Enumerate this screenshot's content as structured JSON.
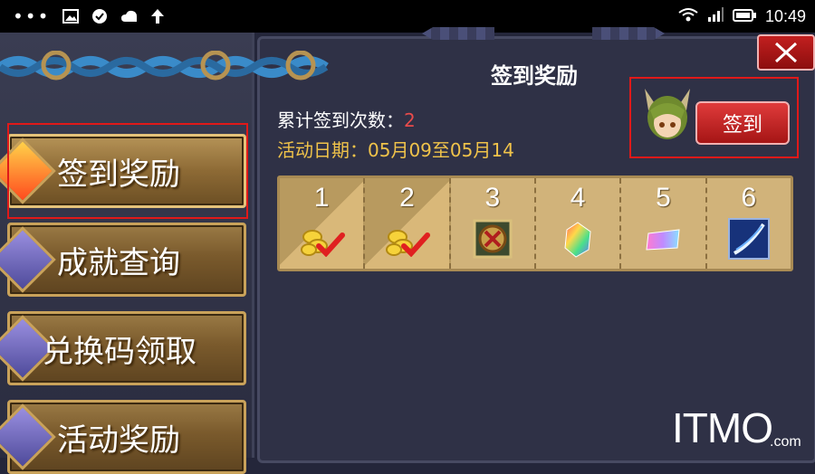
{
  "status_bar": {
    "time": "10:49",
    "icons_left": [
      "more-dots-icon",
      "image-icon",
      "check-circle-icon",
      "cloud-icon",
      "upload-arrow-icon"
    ],
    "icons_right": [
      "wifi-icon",
      "signal-icon",
      "battery-icon"
    ]
  },
  "menu": {
    "items": [
      {
        "label": "签到奖励",
        "active": true
      },
      {
        "label": "成就查询",
        "active": false
      },
      {
        "label": "兑换码领取",
        "active": false
      },
      {
        "label": "活动奖励",
        "active": false
      }
    ]
  },
  "panel": {
    "title": "签到奖励",
    "count_label": "累计签到次数：",
    "count_value": "2",
    "date_line": "活动日期：05月09至05月14",
    "signin_label": "签到"
  },
  "days": [
    {
      "num": "1",
      "reward": "gold-coins-icon",
      "claimed": true
    },
    {
      "num": "2",
      "reward": "gold-coins-icon",
      "claimed": true
    },
    {
      "num": "3",
      "reward": "medal-icon",
      "claimed": false
    },
    {
      "num": "4",
      "reward": "rainbow-crystal-icon",
      "claimed": false
    },
    {
      "num": "5",
      "reward": "rainbow-ticket-icon",
      "claimed": false
    },
    {
      "num": "6",
      "reward": "sword-slash-icon",
      "claimed": false
    }
  ],
  "watermark": {
    "main": "ITMO",
    "suffix": ".com"
  },
  "colors": {
    "accent_red": "#e01919",
    "gold": "#c9a25a",
    "date_text": "#f0c34a"
  }
}
